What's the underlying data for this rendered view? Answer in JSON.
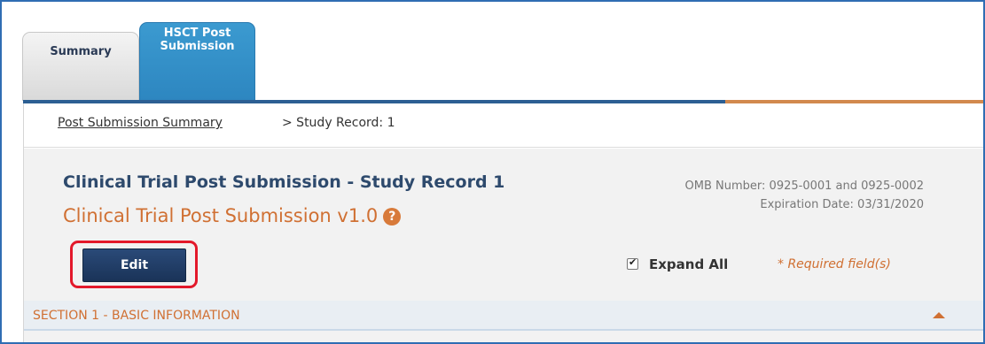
{
  "tabs": [
    {
      "label": "Summary"
    },
    {
      "label_line1": "HSCT Post",
      "label_line2": "Submission"
    }
  ],
  "breadcrumb": {
    "link": "Post Submission Summary",
    "current": "> Study Record: 1"
  },
  "header": {
    "title": "Clinical Trial Post Submission - Study Record 1",
    "subtitle": "Clinical Trial Post Submission v1.0",
    "help_icon": "?",
    "omb_number": "OMB Number: 0925-0001 and 0925-0002",
    "expiration": "Expiration Date: 03/31/2020"
  },
  "actions": {
    "edit_label": "Edit",
    "expand_all_label": "Expand All",
    "expand_all_checked": true,
    "required_note": "* Required field(s)"
  },
  "section": {
    "title": "SECTION 1 - BASIC INFORMATION"
  },
  "colors": {
    "tab_active": "#2d86c0",
    "nav_blue": "#2c5f93",
    "accent_orange": "#d07033",
    "edit_button": "#1f3c66",
    "highlight_red": "#e3192b"
  },
  "icons": {
    "help": "question-circle-icon",
    "checkbox": "checkbox-checked-icon",
    "collapse": "chevron-up-icon"
  }
}
